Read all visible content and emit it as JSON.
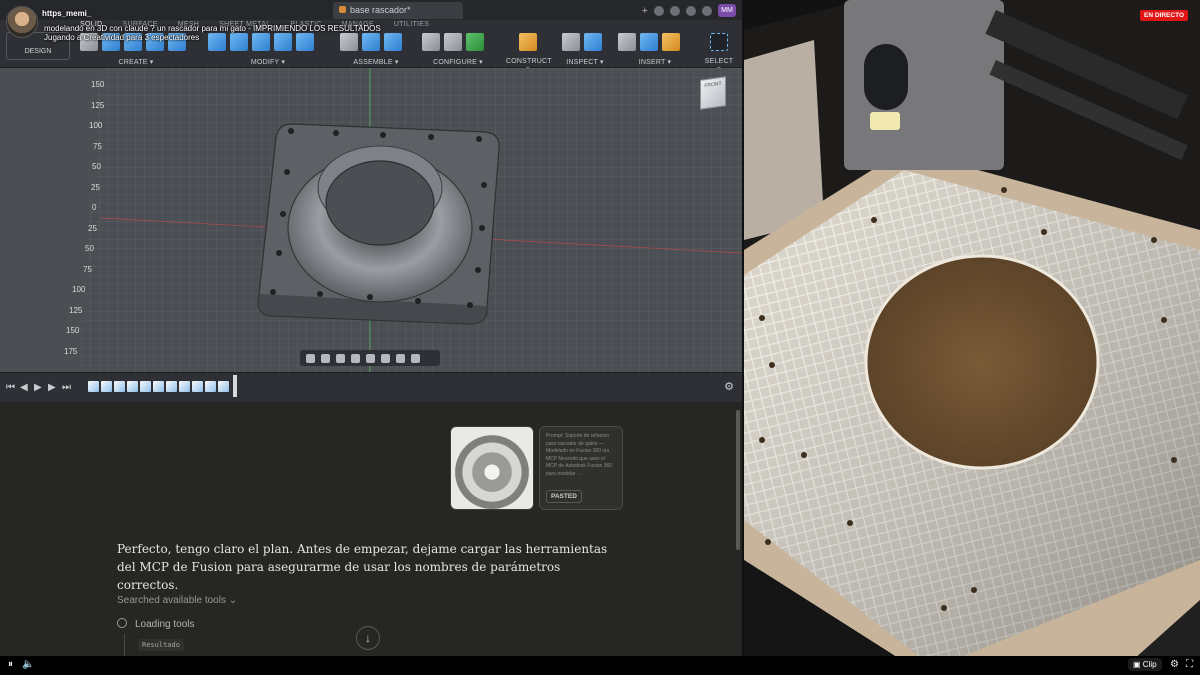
{
  "stream": {
    "streamer_name": "https_memi_",
    "title": "modelando en 3D con claude ? un rascador para mi gato - IMPRIMIENDO LOS RESULTADOS",
    "playing": "Jugando a Creatividad para 3 espectadores",
    "live_badge": "EN DIRECTO",
    "clip_label": "Clip"
  },
  "fusion": {
    "document_tab": "base rascador*",
    "user_initials": "MM",
    "tabs": [
      "SOLID",
      "SURFACE",
      "MESH",
      "SHEET METAL",
      "PLASTIC",
      "MANAGE",
      "UTILITIES"
    ],
    "workspace_button": "DESIGN",
    "groups": [
      {
        "label": "CREATE ▾"
      },
      {
        "label": "MODIFY ▾"
      },
      {
        "label": "ASSEMBLE ▾"
      },
      {
        "label": "CONFIGURE ▾"
      },
      {
        "label": "CONSTRUCT ▾"
      },
      {
        "label": "INSPECT ▾"
      },
      {
        "label": "INSERT ▾"
      },
      {
        "label": "SELECT ▾"
      }
    ],
    "ruler_ticks": [
      "150",
      "125",
      "100",
      "75",
      "50",
      "25",
      "0",
      "25",
      "50",
      "75",
      "100",
      "125",
      "150",
      "175"
    ],
    "viewcube_label": "FRONT"
  },
  "chat": {
    "pasted_text": "Prompt: Soporte de refuerzo para rascador de gatos — Modelado en Fusion 360 vía MCP Necesito que uses el MCP de Autodesk Fusion 360 para modelar ...",
    "pasted_badge": "PASTED",
    "message": "Perfecto, tengo claro el plan. Antes de empezar, dejame cargar las herramientas del MCP de Fusion para asegurarme de usar los nombres de parámetros correctos.",
    "searched_label": "Searched available tools ⌄",
    "loading_label": "Loading tools",
    "result_chip": "Resultado"
  },
  "colors": {
    "live_red": "#e01515",
    "chat_bg": "#262624",
    "viewport_bg": "#4b4e53"
  }
}
